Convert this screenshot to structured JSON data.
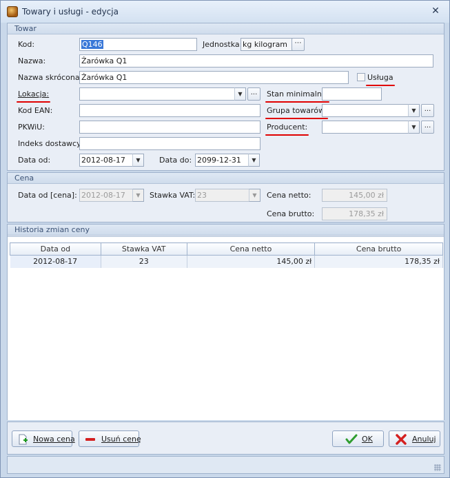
{
  "window": {
    "title": "Towary i usługi - edycja"
  },
  "towar": {
    "section_title": "Towar",
    "kod_label": "Kod:",
    "kod_value": "Q146",
    "jednostka_label": "Jednostka:",
    "jednostka_value": "kg kilogram",
    "nazwa_label": "Nazwa:",
    "nazwa_value": "Żarówka Q1",
    "nazwa_skr_label": "Nazwa skrócona:",
    "nazwa_skr_value": "Żarówka Q1",
    "usluga_label": "Usługa",
    "usluga_checked": false,
    "lokacja_label": "Lokacja:",
    "lokacja_value": "",
    "stan_min_label": "Stan minimalny:",
    "stan_min_value": "",
    "ean_label": "Kod EAN:",
    "ean_value": "",
    "grupa_label": "Grupa towarów:",
    "grupa_value": "",
    "pkwiu_label": "PKWiU:",
    "pkwiu_value": "",
    "producent_label": "Producent:",
    "producent_value": "",
    "indeks_label": "Indeks dostawcy:",
    "indeks_value": "",
    "data_od_label": "Data od:",
    "data_od_value": "2012-08-17",
    "data_do_label": "Data do:",
    "data_do_value": "2099-12-31",
    "ellipsis": "..."
  },
  "cena": {
    "section_title": "Cena",
    "data_od_label": "Data od [cena]:",
    "data_od_value": "2012-08-17",
    "vat_label": "Stawka VAT:",
    "vat_value": "23",
    "netto_label": "Cena netto:",
    "netto_value": "145,00 zł",
    "brutto_label": "Cena brutto:",
    "brutto_value": "178,35 zł"
  },
  "historia": {
    "section_title": "Historia zmian ceny",
    "columns": [
      "Data od",
      "Stawka VAT",
      "Cena netto",
      "Cena brutto"
    ],
    "rows": [
      {
        "data_od": "2012-08-17",
        "vat": "23",
        "netto": "145,00 zł",
        "brutto": "178,35 zł"
      }
    ]
  },
  "buttons": {
    "nowa_cena": "Nowa cena",
    "usun_cene": "Usuń cenę",
    "ok": "OK",
    "anuluj": "Anuluj"
  },
  "colors": {
    "highlight_underline": "#e00000",
    "selection": "#3a78d8"
  }
}
